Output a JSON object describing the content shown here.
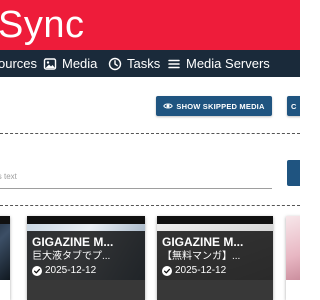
{
  "app": {
    "title": "Sync",
    "colors": {
      "brand": "#ee1c3a",
      "nav": "#1a2a3a",
      "accent": "#1f5480"
    }
  },
  "nav": {
    "items": [
      {
        "label": "ources",
        "icon": "server-icon"
      },
      {
        "label": "Media",
        "icon": "image-icon"
      },
      {
        "label": "Tasks",
        "icon": "clock-icon"
      },
      {
        "label": "Media Servers",
        "icon": "menu-lines-icon"
      }
    ]
  },
  "toolbar": {
    "show_skipped_label": "SHOW SKIPPED MEDIA",
    "show_skipped_icon": "eye-icon",
    "next_button_label": "C"
  },
  "search": {
    "placeholder": "is text",
    "value": ""
  },
  "media": [
    {
      "title": "",
      "subtitle": "",
      "date": ""
    },
    {
      "title": "GIGAZINE M...",
      "subtitle": "巨大液タブでプ...",
      "date": "2025-12-12",
      "status_icon": "check-circle-icon"
    },
    {
      "title": "GIGAZINE M...",
      "subtitle": "【無料マンガ】...",
      "date": "2025-12-12",
      "status_icon": "check-circle-icon"
    },
    {
      "title": "",
      "subtitle": "",
      "date": ""
    }
  ]
}
